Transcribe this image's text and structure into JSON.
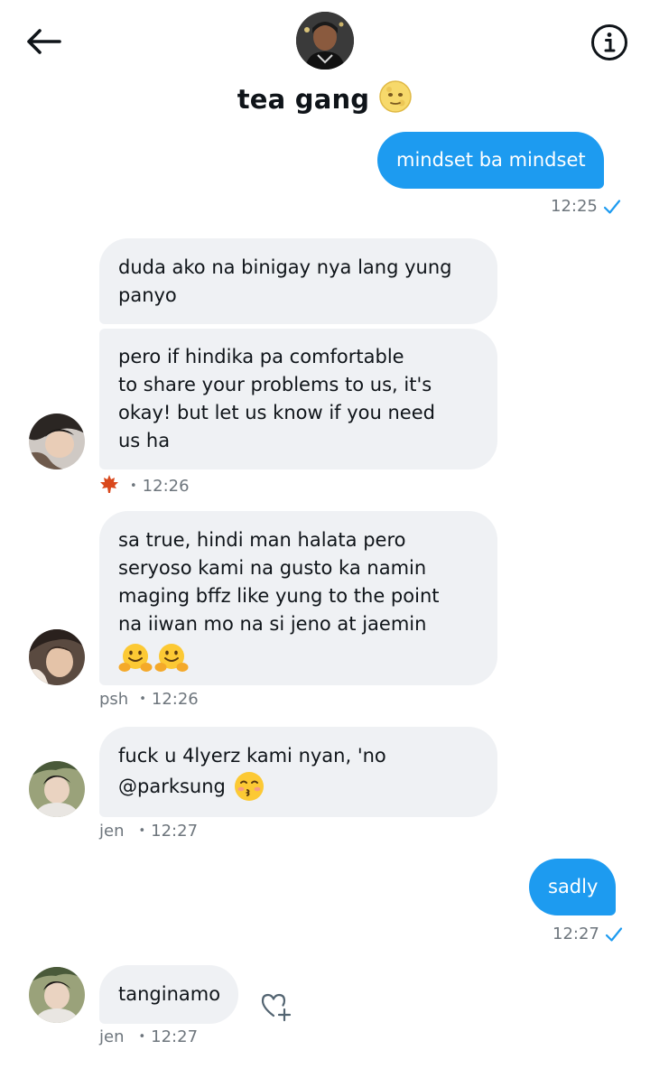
{
  "header": {
    "title": "tea gang",
    "title_emoji": "moon-face-emoji",
    "back_icon": "arrow-left-icon",
    "info_icon": "info-circle-icon"
  },
  "colors": {
    "accent": "#1d9bf0",
    "incoming_bubble": "#eff1f4",
    "meta_text": "#6e767d"
  },
  "messages": [
    {
      "direction": "out",
      "text": "mindset ba mindset",
      "time": "12:25",
      "status": "sent-check-icon"
    },
    {
      "direction": "in",
      "text_line1": "duda ako na binigay nya lang yung",
      "text_line2": "panyo"
    },
    {
      "direction": "in",
      "text_line1": "pero if hindika pa comfortable",
      "text_line2": "to share your problems to us, it's",
      "text_line3": "okay! but let us know if you need",
      "text_line4": "us ha",
      "sender_icon": "maple-leaf-emoji",
      "time": "12:26"
    },
    {
      "direction": "in",
      "text_line1": "sa true, hindi man halata pero",
      "text_line2": "seryoso kami na gusto ka namin",
      "text_line3": "maging bffz like yung to the point",
      "text_line4": "na iiwan mo na si jeno at jaemin",
      "emoji": "hugging-face-emoji",
      "sender": "psh",
      "time": "12:26"
    },
    {
      "direction": "in",
      "text_line1": "fuck u 4lyerz kami nyan, 'no",
      "text_line2": "@parksung",
      "emoji": "kissing-face-emoji",
      "sender": "jen",
      "time": "12:27"
    },
    {
      "direction": "out",
      "text": "sadly",
      "time": "12:27",
      "status": "sent-check-icon"
    },
    {
      "direction": "in",
      "text": "tanginamo",
      "sender": "jen",
      "time": "12:27",
      "react_icon": "heart-plus-icon"
    }
  ],
  "separator": "•"
}
